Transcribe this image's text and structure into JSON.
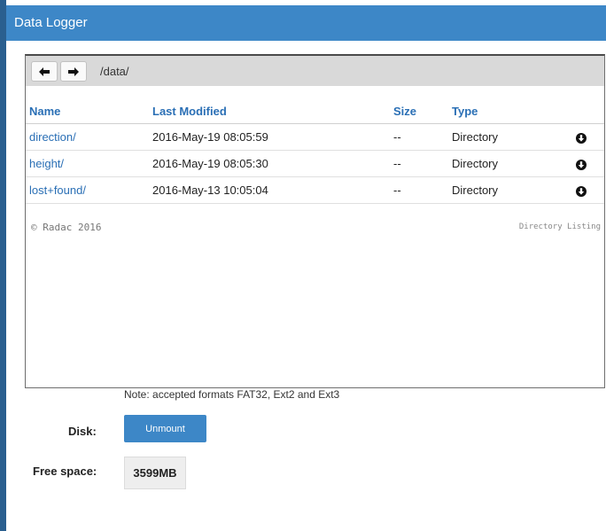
{
  "app": {
    "title": "Data Logger"
  },
  "browser": {
    "path": "/data/",
    "columns": {
      "name": "Name",
      "modified": "Last Modified",
      "size": "Size",
      "type": "Type"
    },
    "rows": [
      {
        "name": "direction/",
        "modified": "2016-May-19 08:05:59",
        "size": "--",
        "type": "Directory"
      },
      {
        "name": "height/",
        "modified": "2016-May-19 08:05:30",
        "size": "--",
        "type": "Directory"
      },
      {
        "name": "lost+found/",
        "modified": "2016-May-13 10:05:04",
        "size": "--",
        "type": "Directory"
      }
    ],
    "copyright": "© Radac 2016",
    "listing_label": "Directory Listing"
  },
  "note": "Note: accepted formats FAT32, Ext2 and Ext3",
  "disk": {
    "label": "Disk:",
    "button": "Unmount"
  },
  "free_space": {
    "label": "Free space:",
    "value": "3599MB"
  },
  "icons": {
    "back": "arrow-left-icon",
    "forward": "arrow-right-icon",
    "download": "download-icon"
  },
  "colors": {
    "accent": "#3d87c7",
    "link": "#2a6fb5"
  }
}
